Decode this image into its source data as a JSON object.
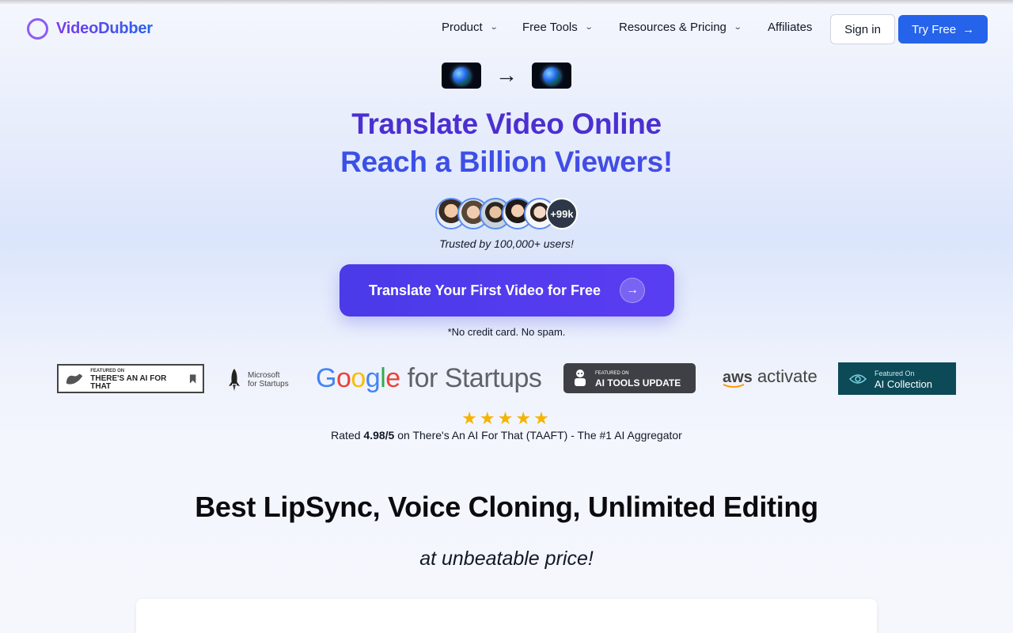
{
  "nav": {
    "brand": "VideoDubber",
    "menu": [
      {
        "label": "Product",
        "has_dropdown": true
      },
      {
        "label": "Free Tools",
        "has_dropdown": true
      },
      {
        "label": "Resources & Pricing",
        "has_dropdown": true
      },
      {
        "label": "Affiliates",
        "has_dropdown": false
      }
    ],
    "sign_in": "Sign in",
    "try_free": "Try Free"
  },
  "hero": {
    "title_line1": "Translate Video Online",
    "title_line2": "Reach a Billion Viewers!",
    "avatars_more": "+99k",
    "trusted": "Trusted by 100,000+ users!",
    "cta": "Translate Your First Video for Free",
    "no_cc": "*No credit card. No spam."
  },
  "badges": {
    "taaft_small": "FEATURED ON",
    "taaft_big": "THERE'S AN AI FOR THAT",
    "microsoft_line1": "Microsoft",
    "microsoft_line2": "for Startups",
    "google": "for Startups",
    "aitools_small": "FEATURED ON",
    "aitools_big": "AI TOOLS UPDATE",
    "aws": "aws",
    "aws_activate": "activate",
    "aicollection_small": "Featured On",
    "aicollection_big": "AI Collection"
  },
  "rating": {
    "stars": "★★★★★",
    "prefix": "Rated ",
    "score": "4.98/5",
    "suffix": " on There's An AI For That (TAAFT) - The #1 AI Aggregator"
  },
  "section": {
    "title": "Best LipSync, Voice Cloning, Unlimited Editing",
    "subtitle": "at unbeatable price!"
  },
  "colors": {
    "primary": "#2563eb",
    "cta": "#4f3de8",
    "headline_purple": "#4c2fd1",
    "star": "#f5b400"
  }
}
